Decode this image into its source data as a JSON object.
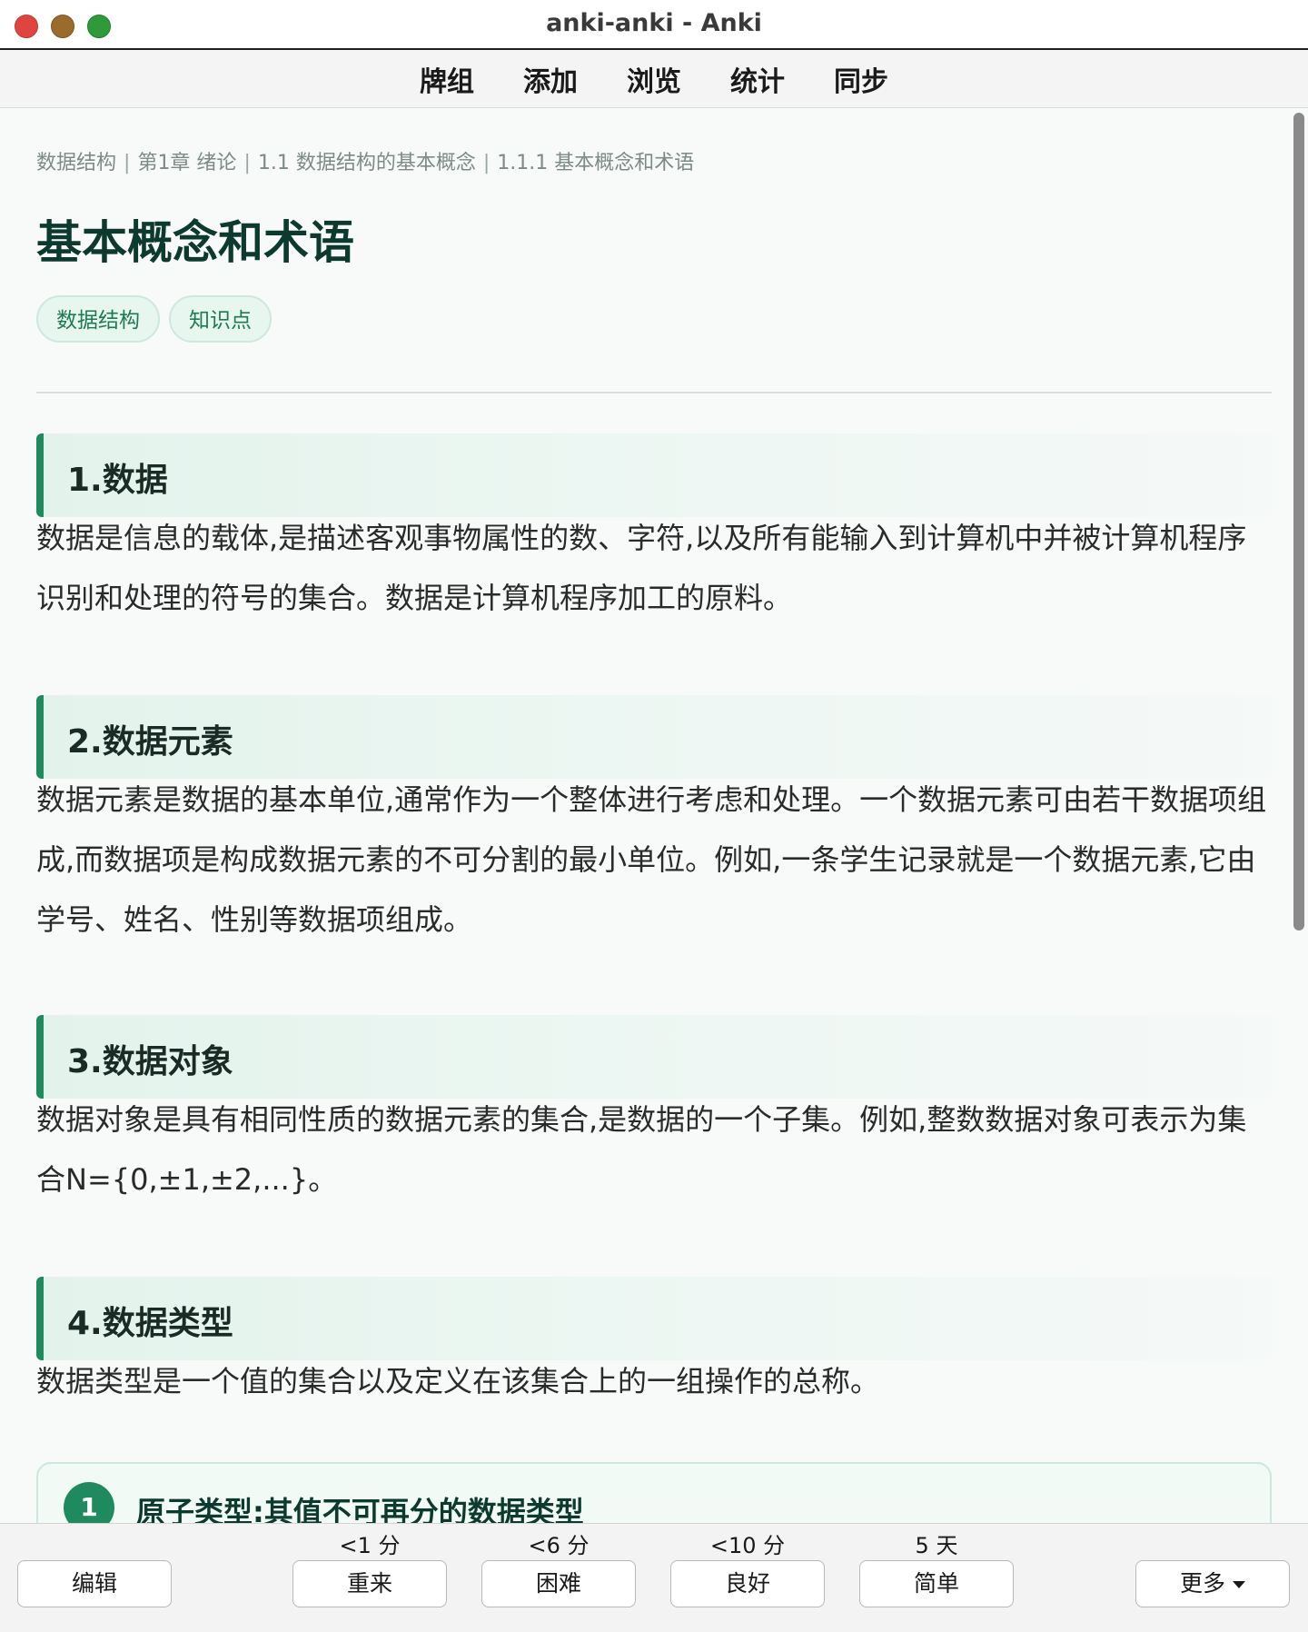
{
  "window": {
    "title": "anki-anki - Anki"
  },
  "nav": {
    "items": [
      "牌组",
      "添加",
      "浏览",
      "统计",
      "同步"
    ]
  },
  "card": {
    "breadcrumb": [
      "数据结构",
      "第1章 绪论",
      "1.1 数据结构的基本概念",
      "1.1.1 基本概念和术语"
    ],
    "breadcrumb_sep": "|",
    "title": "基本概念和术语",
    "tags": [
      "数据结构",
      "知识点"
    ],
    "sections": [
      {
        "heading": "1.数据",
        "body": "数据是信息的载体,是描述客观事物属性的数、字符,以及所有能输入到计算机中并被计算机程序识别和处理的符号的集合。数据是计算机程序加工的原料。"
      },
      {
        "heading": "2.数据元素",
        "body": "数据元素是数据的基本单位,通常作为一个整体进行考虑和处理。一个数据元素可由若干数据项组成,而数据项是构成数据元素的不可分割的最小单位。例如,一条学生记录就是一个数据元素,它由学号、姓名、性别等数据项组成。"
      },
      {
        "heading": "3.数据对象",
        "body": "数据对象是具有相同性质的数据元素的集合,是数据的一个子集。例如,整数数据对象可表示为集合N={0,±1,±2,...}。"
      },
      {
        "heading": "4.数据类型",
        "body": "数据类型是一个值的集合以及定义在该集合上的一组操作的总称。"
      }
    ],
    "subitem": {
      "number": "1",
      "title": "原子类型:其值不可再分的数据类型"
    }
  },
  "bottom": {
    "edit_label": "编辑",
    "more_label": "更多",
    "answers": [
      {
        "label": "重来",
        "interval": "<1 分"
      },
      {
        "label": "困难",
        "interval": "<6 分"
      },
      {
        "label": "良好",
        "interval": "<10 分"
      },
      {
        "label": "简单",
        "interval": "5 天"
      }
    ]
  },
  "icons": {
    "more_dropdown": "caret-down-icon"
  },
  "colors": {
    "accent": "#1f8a5e",
    "title": "#0d3a2e",
    "tag_bg": "#e7f6ef"
  }
}
